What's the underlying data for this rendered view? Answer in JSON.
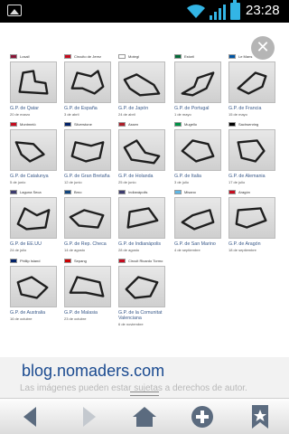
{
  "status": {
    "time": "23:28"
  },
  "page": {
    "blog_title": "blog.nomaders.com",
    "faded_text": "Las imágenes pueden estar sujetas a derechos de autor."
  },
  "colors": {
    "accent": "#33b5e5",
    "link": "#3a5a8a",
    "blog": "#1a4a90"
  },
  "circuits": [
    {
      "track": "Losail",
      "name": "G.P. de Qatar",
      "date": "20 de marzo"
    },
    {
      "track": "Circuito de Jerez",
      "name": "G.P. de España",
      "date": "3 de abril"
    },
    {
      "track": "Motegi",
      "name": "G.P. de Japón",
      "date": "24 de abril"
    },
    {
      "track": "Estoril",
      "name": "G.P. de Portugal",
      "date": "1 de mayo"
    },
    {
      "track": "Le Mans",
      "name": "G.P. de Francia",
      "date": "15 de mayo"
    },
    {
      "track": "Montmeló",
      "name": "G.P. de Catalunya",
      "date": "5 de junio"
    },
    {
      "track": "Silverstone",
      "name": "G.P. de Gran Bretaña",
      "date": "12 de junio"
    },
    {
      "track": "Assen",
      "name": "G.P. de Holanda",
      "date": "25 de junio"
    },
    {
      "track": "Mugello",
      "name": "G.P. de Italia",
      "date": "3 de julio"
    },
    {
      "track": "Sachsenring",
      "name": "G.P. de Alemania",
      "date": "17 de julio"
    },
    {
      "track": "Laguna Seca",
      "name": "G.P. de EE.UU",
      "date": "24 de julio"
    },
    {
      "track": "Brno",
      "name": "G.P. de Rep. Checa",
      "date": "14 de agosto"
    },
    {
      "track": "Indianápolis",
      "name": "G.P. de Indianápolis",
      "date": "28 de agosto"
    },
    {
      "track": "Misano",
      "name": "G.P. de San Marino",
      "date": "4 de septiembre"
    },
    {
      "track": "Aragón",
      "name": "G.P. de Aragón",
      "date": "18 de septiembre"
    },
    {
      "track": "Phillip Island",
      "name": "G.P. de Australia",
      "date": "16 de octubre"
    },
    {
      "track": "Sepang",
      "name": "G.P. de Malasia",
      "date": "23 de octubre"
    },
    {
      "track": "Circuit Ricardo Tormo",
      "name": "G.P. de la Comunitat Valenciana",
      "date": "6 de noviembre"
    }
  ],
  "icons": {
    "status": [
      "picture-icon",
      "wifi-icon",
      "signal-icon",
      "battery-icon"
    ],
    "nav": [
      "back-icon",
      "forward-icon",
      "home-icon",
      "add-icon",
      "bookmark-icon"
    ]
  }
}
